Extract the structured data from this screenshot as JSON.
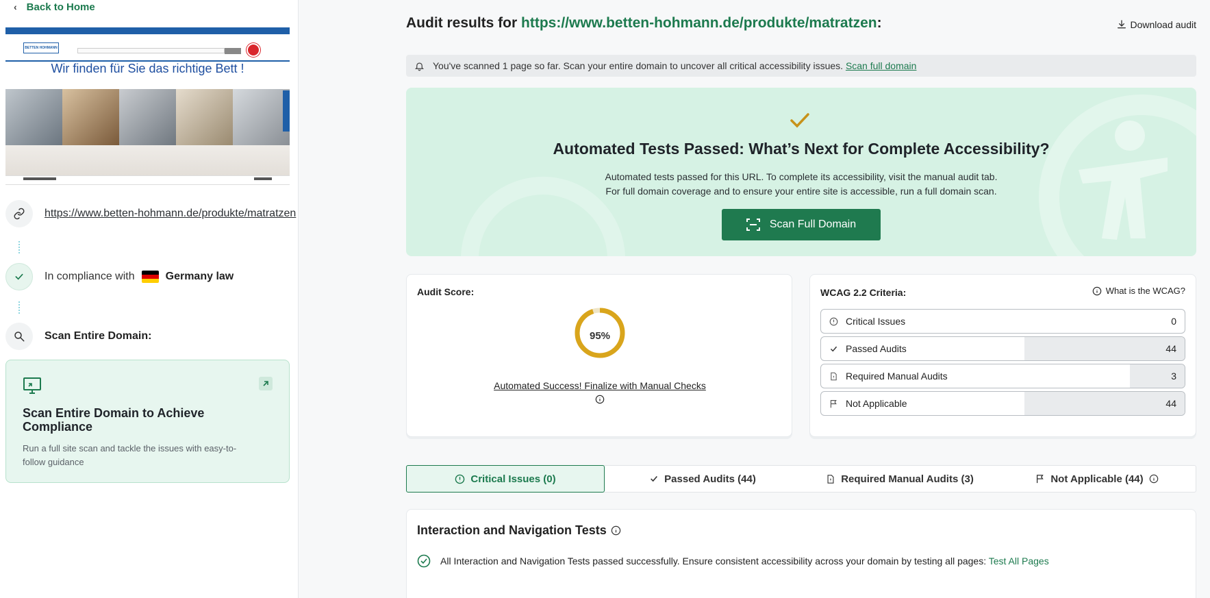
{
  "sidebar": {
    "back_label": "Back to Home",
    "preview": {
      "headline": "Wir finden für Sie das richtige Bett !",
      "logo": "BETTEN HOHMANN"
    },
    "url": "https://www.betten-hohmann.de/produkte/matratzen",
    "compliance_prefix": "In compliance with",
    "law": "Germany law",
    "scan_entire_label": "Scan Entire Domain:",
    "cta": {
      "title": "Scan Entire Domain to Achieve Compliance",
      "description": "Run a full site scan and tackle the issues with easy-to-follow guidance"
    }
  },
  "header": {
    "title_prefix": "Audit results for",
    "title_url": "https://www.betten-hohmann.de/produkte/matratzen",
    "title_suffix": ":",
    "download_label": "Download audit"
  },
  "notice": {
    "text": "You've scanned 1 page so far. Scan your entire domain to uncover all critical accessibility issues.",
    "link": "Scan full domain"
  },
  "hero": {
    "title": "Automated Tests Passed: What’s Next for Complete Accessibility?",
    "line1": "Automated tests passed for this URL. To complete its accessibility, visit the manual audit tab.",
    "line2": "For full domain coverage and to ensure your entire site is accessible, run a full domain scan.",
    "button": "Scan Full Domain"
  },
  "score": {
    "label": "Audit Score:",
    "value": "95%",
    "percent": 95,
    "finalize": "Automated Success! Finalize with Manual Checks"
  },
  "wcag": {
    "label": "WCAG 2.2 Criteria:",
    "what_label": "What is the WCAG?",
    "rows": [
      {
        "name": "Critical Issues",
        "count": "0",
        "fraction": 0
      },
      {
        "name": "Passed Audits",
        "count": "44",
        "fraction": 0.44
      },
      {
        "name": "Required Manual Audits",
        "count": "3",
        "fraction": 0.15
      },
      {
        "name": "Not Applicable",
        "count": "44",
        "fraction": 0.44
      }
    ]
  },
  "tabs": [
    {
      "label": "Critical Issues (0)"
    },
    {
      "label": "Passed Audits (44)"
    },
    {
      "label": "Required Manual Audits (3)"
    },
    {
      "label": "Not Applicable (44)"
    }
  ],
  "tests": {
    "title": "Interaction and Navigation Tests",
    "message": "All Interaction and Navigation Tests passed successfully. Ensure consistent accessibility across your domain by testing all pages:",
    "link": "Test All Pages"
  },
  "colors": {
    "accent": "#1c7a4e",
    "score_ring": "#d9a51c",
    "hero_bg": "#d6f2e4"
  }
}
